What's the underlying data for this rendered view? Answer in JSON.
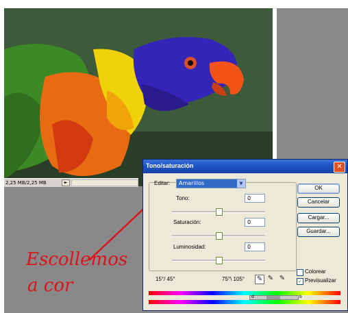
{
  "status_bar": {
    "size_text": "2,25 MB/2,25 MB",
    "arrow": "►"
  },
  "dialog": {
    "title": "Tono/saturación",
    "close": "✕",
    "edit_label": "Editar:",
    "edit_value": "Amarillos",
    "hue_label": "Tono:",
    "hue_value": "0",
    "saturation_label": "Saturación:",
    "saturation_value": "0",
    "lightness_label": "Luminosidad:",
    "lightness_value": "0",
    "range_left": "15°/ 45°",
    "range_right": "75°\\ 105°",
    "buttons": {
      "ok": "OK",
      "cancel": "Cancelar",
      "load": "Cargar...",
      "save": "Guardar..."
    },
    "colorize_label": "Colorear",
    "preview_label": "Previsualizar",
    "preview_checked": "✓",
    "range_mark_left": "d",
    "range_mark_right": "b"
  },
  "annotation": {
    "line1": "Escollemos",
    "line2": "a cor"
  },
  "colors": {
    "titlebar": "#2057c8",
    "annotation": "#d9141c",
    "dialog_bg": "#ece9d8"
  }
}
